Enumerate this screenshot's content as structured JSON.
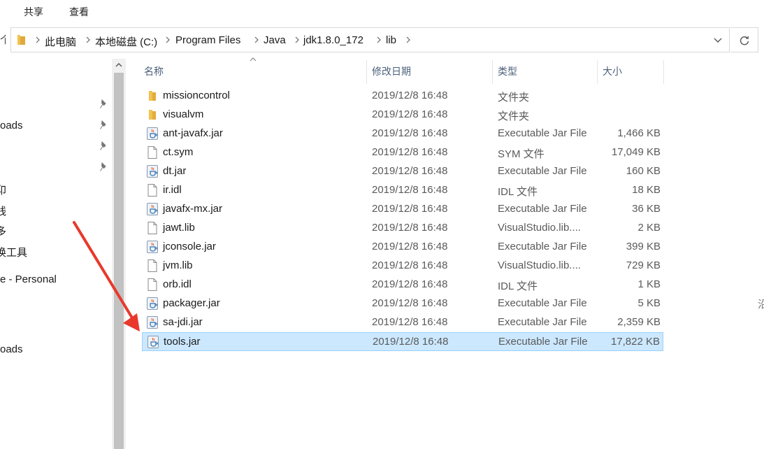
{
  "ribbon": {
    "tabs": [
      "共享",
      "查看"
    ]
  },
  "address": {
    "crumbs": [
      "此电脑",
      "本地磁盘 (C:)",
      "Program Files",
      "Java",
      "jdk1.8.0_172",
      "lib"
    ]
  },
  "nav": {
    "items": [
      "oads",
      "卬",
      "线",
      "多",
      "换工具",
      "e - Personal",
      "oads"
    ]
  },
  "columns": {
    "name": "名称",
    "date": "修改日期",
    "type": "类型",
    "size": "大小"
  },
  "files": [
    {
      "name": "missioncontrol",
      "date": "2019/12/8 16:48",
      "type": "文件夹",
      "size": "",
      "icon": "folder-icon"
    },
    {
      "name": "visualvm",
      "date": "2019/12/8 16:48",
      "type": "文件夹",
      "size": "",
      "icon": "folder-icon"
    },
    {
      "name": "ant-javafx.jar",
      "date": "2019/12/8 16:48",
      "type": "Executable Jar File",
      "size": "1,466 KB",
      "icon": "jar-file-icon"
    },
    {
      "name": "ct.sym",
      "date": "2019/12/8 16:48",
      "type": "SYM 文件",
      "size": "17,049 KB",
      "icon": "generic-file-icon"
    },
    {
      "name": "dt.jar",
      "date": "2019/12/8 16:48",
      "type": "Executable Jar File",
      "size": "160 KB",
      "icon": "jar-file-icon"
    },
    {
      "name": "ir.idl",
      "date": "2019/12/8 16:48",
      "type": "IDL 文件",
      "size": "18 KB",
      "icon": "generic-file-icon"
    },
    {
      "name": "javafx-mx.jar",
      "date": "2019/12/8 16:48",
      "type": "Executable Jar File",
      "size": "36 KB",
      "icon": "jar-file-icon"
    },
    {
      "name": "jawt.lib",
      "date": "2019/12/8 16:48",
      "type": "VisualStudio.lib....",
      "size": "2 KB",
      "icon": "generic-file-icon"
    },
    {
      "name": "jconsole.jar",
      "date": "2019/12/8 16:48",
      "type": "Executable Jar File",
      "size": "399 KB",
      "icon": "jar-file-icon"
    },
    {
      "name": "jvm.lib",
      "date": "2019/12/8 16:48",
      "type": "VisualStudio.lib....",
      "size": "729 KB",
      "icon": "generic-file-icon"
    },
    {
      "name": "orb.idl",
      "date": "2019/12/8 16:48",
      "type": "IDL 文件",
      "size": "1 KB",
      "icon": "generic-file-icon"
    },
    {
      "name": "packager.jar",
      "date": "2019/12/8 16:48",
      "type": "Executable Jar File",
      "size": "5 KB",
      "icon": "jar-file-icon"
    },
    {
      "name": "sa-jdi.jar",
      "date": "2019/12/8 16:48",
      "type": "Executable Jar File",
      "size": "2,359 KB",
      "icon": "jar-file-icon"
    },
    {
      "name": "tools.jar",
      "date": "2019/12/8 16:48",
      "type": "Executable Jar File",
      "size": "17,822 KB",
      "icon": "jar-file-icon",
      "selected": true
    }
  ],
  "edge_text": "沿",
  "colors": {
    "selection": "#cce8ff",
    "selection_border": "#99d1ff",
    "arrow": "#e8392c",
    "folder": "#f2c14e"
  }
}
